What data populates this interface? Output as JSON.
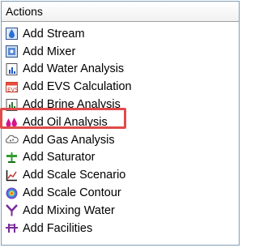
{
  "panel": {
    "header": "Actions",
    "items": [
      {
        "label": "Add Stream",
        "icon": "stream-icon"
      },
      {
        "label": "Add Mixer",
        "icon": "mixer-icon"
      },
      {
        "label": "Add Water Analysis",
        "icon": "water-analysis-icon"
      },
      {
        "label": "Add EVS Calculation",
        "icon": "evs-calculation-icon"
      },
      {
        "label": "Add Brine Analysis",
        "icon": "brine-analysis-icon"
      },
      {
        "label": "Add Oil Analysis",
        "icon": "oil-analysis-icon"
      },
      {
        "label": "Add Gas Analysis",
        "icon": "gas-analysis-icon"
      },
      {
        "label": "Add Saturator",
        "icon": "saturator-icon"
      },
      {
        "label": "Add Scale Scenario",
        "icon": "scale-scenario-icon"
      },
      {
        "label": "Add Scale Contour",
        "icon": "scale-contour-icon"
      },
      {
        "label": "Add Mixing Water",
        "icon": "mixing-water-icon"
      },
      {
        "label": "Add Facilities",
        "icon": "facilities-icon"
      }
    ]
  },
  "colors": {
    "highlight_border": "#e04a4a",
    "panel_border": "#7f9db9"
  }
}
